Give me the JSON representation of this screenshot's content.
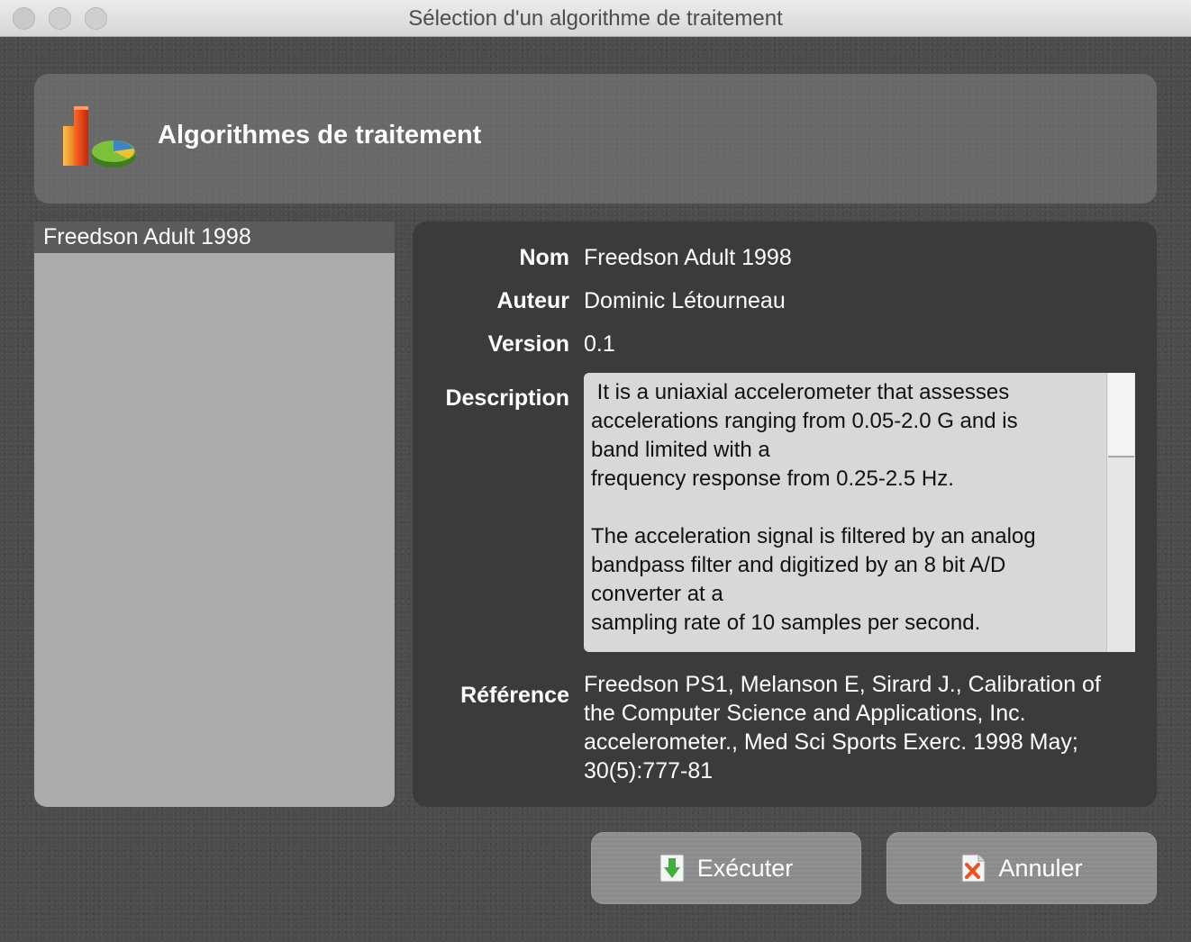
{
  "window": {
    "title": "Sélection d'un algorithme de traitement"
  },
  "header": {
    "title": "Algorithmes de traitement",
    "icon": "chart-icon"
  },
  "algorithm_list": {
    "items": [
      {
        "label": "Freedson Adult 1998",
        "selected": true
      }
    ]
  },
  "details": {
    "labels": {
      "name": "Nom",
      "author": "Auteur",
      "version": "Version",
      "description": "Description",
      "reference": "Référence"
    },
    "name": "Freedson Adult 1998",
    "author": "Dominic Létourneau",
    "version": "0.1",
    "description": " It is a uniaxial accelerometer that assesses\naccelerations ranging from 0.05-2.0 G and is\nband limited with a\nfrequency response from 0.25-2.5 Hz.\n\nThe acceleration signal is filtered by an analog\nbandpass filter and digitized by an 8 bit A/D\nconverter at a\nsampling rate of 10 samples per second.",
    "reference": "Freedson PS1, Melanson E, Sirard J., Calibration of\nthe Computer Science and Applications, Inc.\naccelerometer., Med Sci Sports Exerc. 1998 May;\n30(5):777-81"
  },
  "buttons": {
    "execute": {
      "label": "Exécuter",
      "icon": "download-arrow-icon"
    },
    "cancel": {
      "label": "Annuler",
      "icon": "cancel-document-icon"
    }
  },
  "colors": {
    "background": "#4c4c4c",
    "selected_item": "#5b5b5b",
    "details_panel": "#3b3b3b"
  }
}
